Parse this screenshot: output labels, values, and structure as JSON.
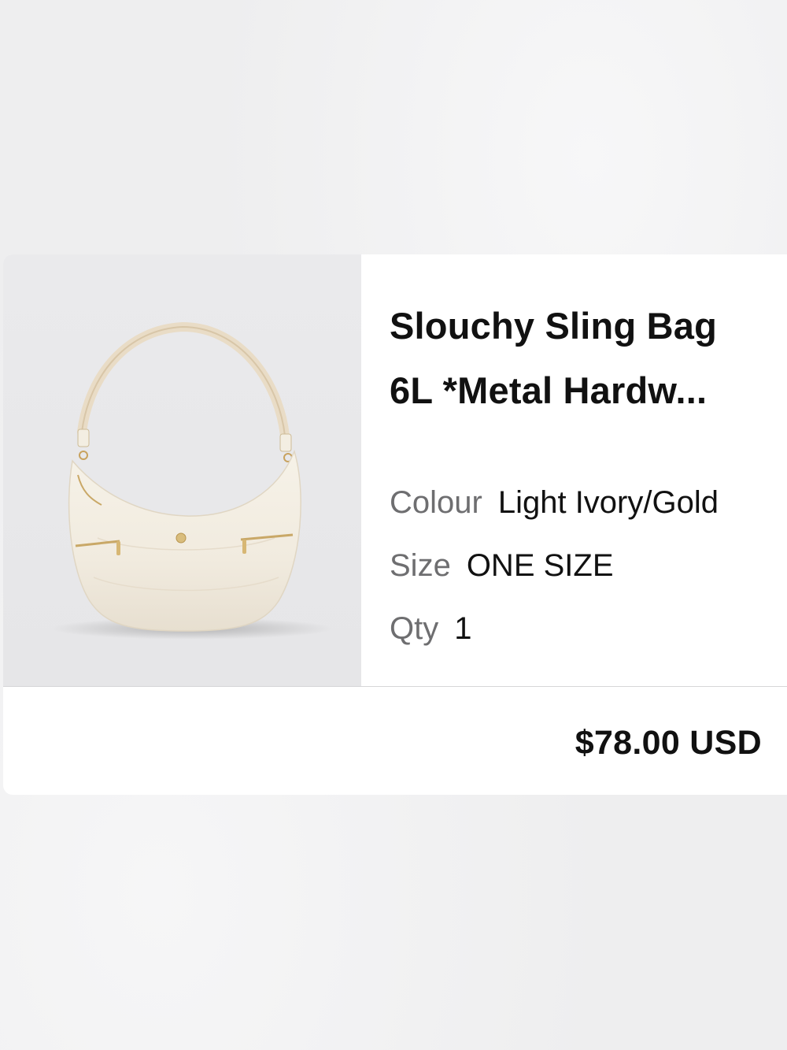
{
  "cart_item": {
    "title_line1": "Slouchy Sling Bag",
    "title_line2": "6L *Metal Hardw...",
    "attributes": [
      {
        "label": "Colour",
        "value": "Light Ivory/Gold"
      },
      {
        "label": "Size",
        "value": "ONE SIZE"
      },
      {
        "label": "Qty",
        "value": "1"
      }
    ],
    "price": "$78.00 USD",
    "image_icon": "sling-bag-photo"
  },
  "colors": {
    "background": "#eeeeef",
    "card": "#ffffff",
    "image_bg": "#e8e8ea",
    "label_text": "#6e6e70",
    "value_text": "#111111"
  }
}
